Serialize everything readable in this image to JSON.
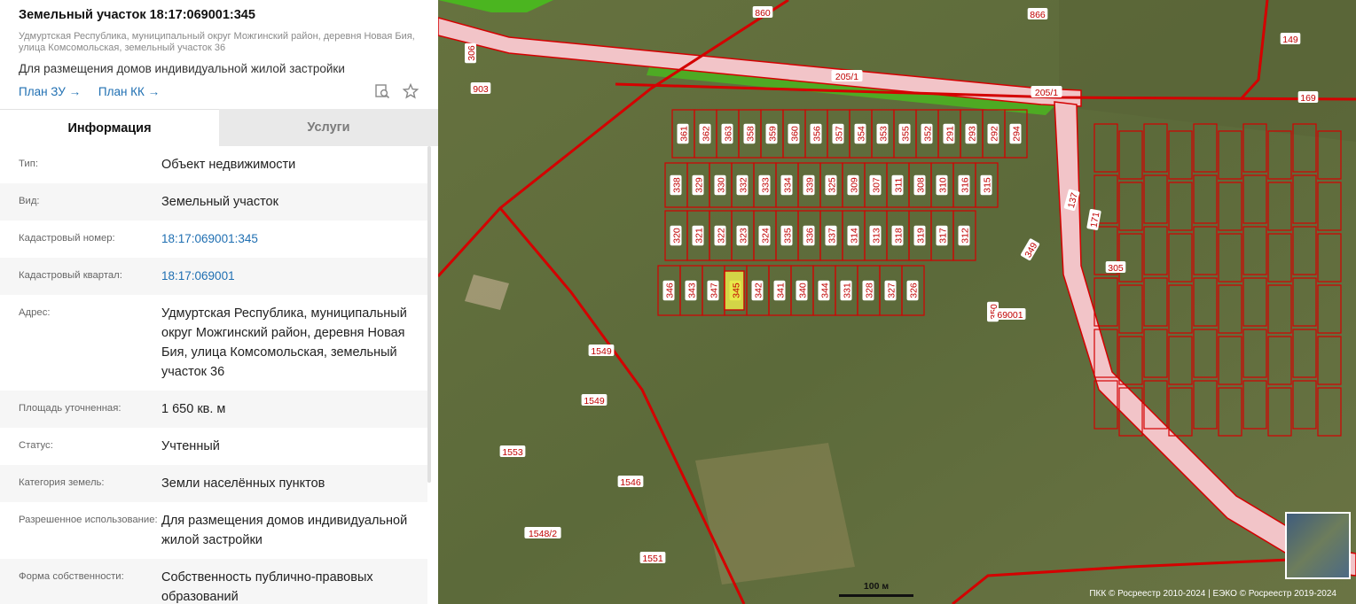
{
  "header": {
    "title": "Земельный участок 18:17:069001:345",
    "address_short": "Удмуртская Республика, муниципальный округ Можгинский район, деревня Новая Бия, улица Комсомольская, земельный участок 36",
    "purpose": "Для размещения домов индивидуальной жилой застройки",
    "plan_zu": "План ЗУ →",
    "plan_kk": "План КК →"
  },
  "tabs": [
    {
      "label": "Информация",
      "active": true
    },
    {
      "label": "Услуги",
      "active": false
    }
  ],
  "rows": [
    {
      "label": "Тип:",
      "value": "Объект недвижимости",
      "link": false
    },
    {
      "label": "Вид:",
      "value": "Земельный участок",
      "link": false
    },
    {
      "label": "Кадастровый номер:",
      "value": "18:17:069001:345",
      "link": true
    },
    {
      "label": "Кадастровый квартал:",
      "value": "18:17:069001",
      "link": true
    },
    {
      "label": "Адрес:",
      "value": "Удмуртская Республика, муниципальный округ Можгинский район, деревня Новая Бия, улица Комсомольская, земельный участок 36",
      "link": false
    },
    {
      "label": "Площадь уточненная:",
      "value": "1 650 кв. м",
      "link": false
    },
    {
      "label": "Статус:",
      "value": "Учтенный",
      "link": false
    },
    {
      "label": "Категория земель:",
      "value": "Земли населённых пунктов",
      "link": false
    },
    {
      "label": "Разрешенное использование:",
      "value": "Для размещения домов индивидуальной жилой застройки",
      "link": false
    },
    {
      "label": "Форма собственности:",
      "value": "Собственность публично-правовых образований",
      "link": false
    }
  ],
  "map": {
    "scale_label": "100 м",
    "copyright": "ПКК © Росреестр 2010-2024 | ЕЭКО © Росреестр 2019-2024",
    "selected_parcel": "345",
    "quarter_label": "69001",
    "road_labels": [
      "205/1",
      "205/1"
    ],
    "row1_parcels": [
      "361",
      "362",
      "363",
      "358",
      "359",
      "360",
      "356",
      "357",
      "354",
      "353",
      "355",
      "352",
      "291",
      "293",
      "292",
      "294"
    ],
    "row2_parcels": [
      "338",
      "329",
      "330",
      "332",
      "333",
      "334",
      "339",
      "325",
      "309",
      "307",
      "311",
      "308",
      "310",
      "316",
      "315"
    ],
    "row3_parcels": [
      "320",
      "321",
      "322",
      "323",
      "324",
      "335",
      "336",
      "337",
      "314",
      "313",
      "318",
      "319",
      "317",
      "312"
    ],
    "row4_parcels": [
      "346",
      "343",
      "347",
      "345",
      "342",
      "341",
      "340",
      "344",
      "331",
      "328",
      "327",
      "326"
    ],
    "misc_labels": [
      "860",
      "866",
      "149",
      "169",
      "903",
      "306",
      "1549",
      "1549",
      "1553",
      "1546",
      "1548/2",
      "1551",
      "350",
      "349",
      "305",
      "137",
      "171"
    ],
    "colors": {
      "boundary": "#d40000",
      "road": "#f2c4c8",
      "selected": "#e8e84a",
      "green": "#4bb520"
    }
  }
}
